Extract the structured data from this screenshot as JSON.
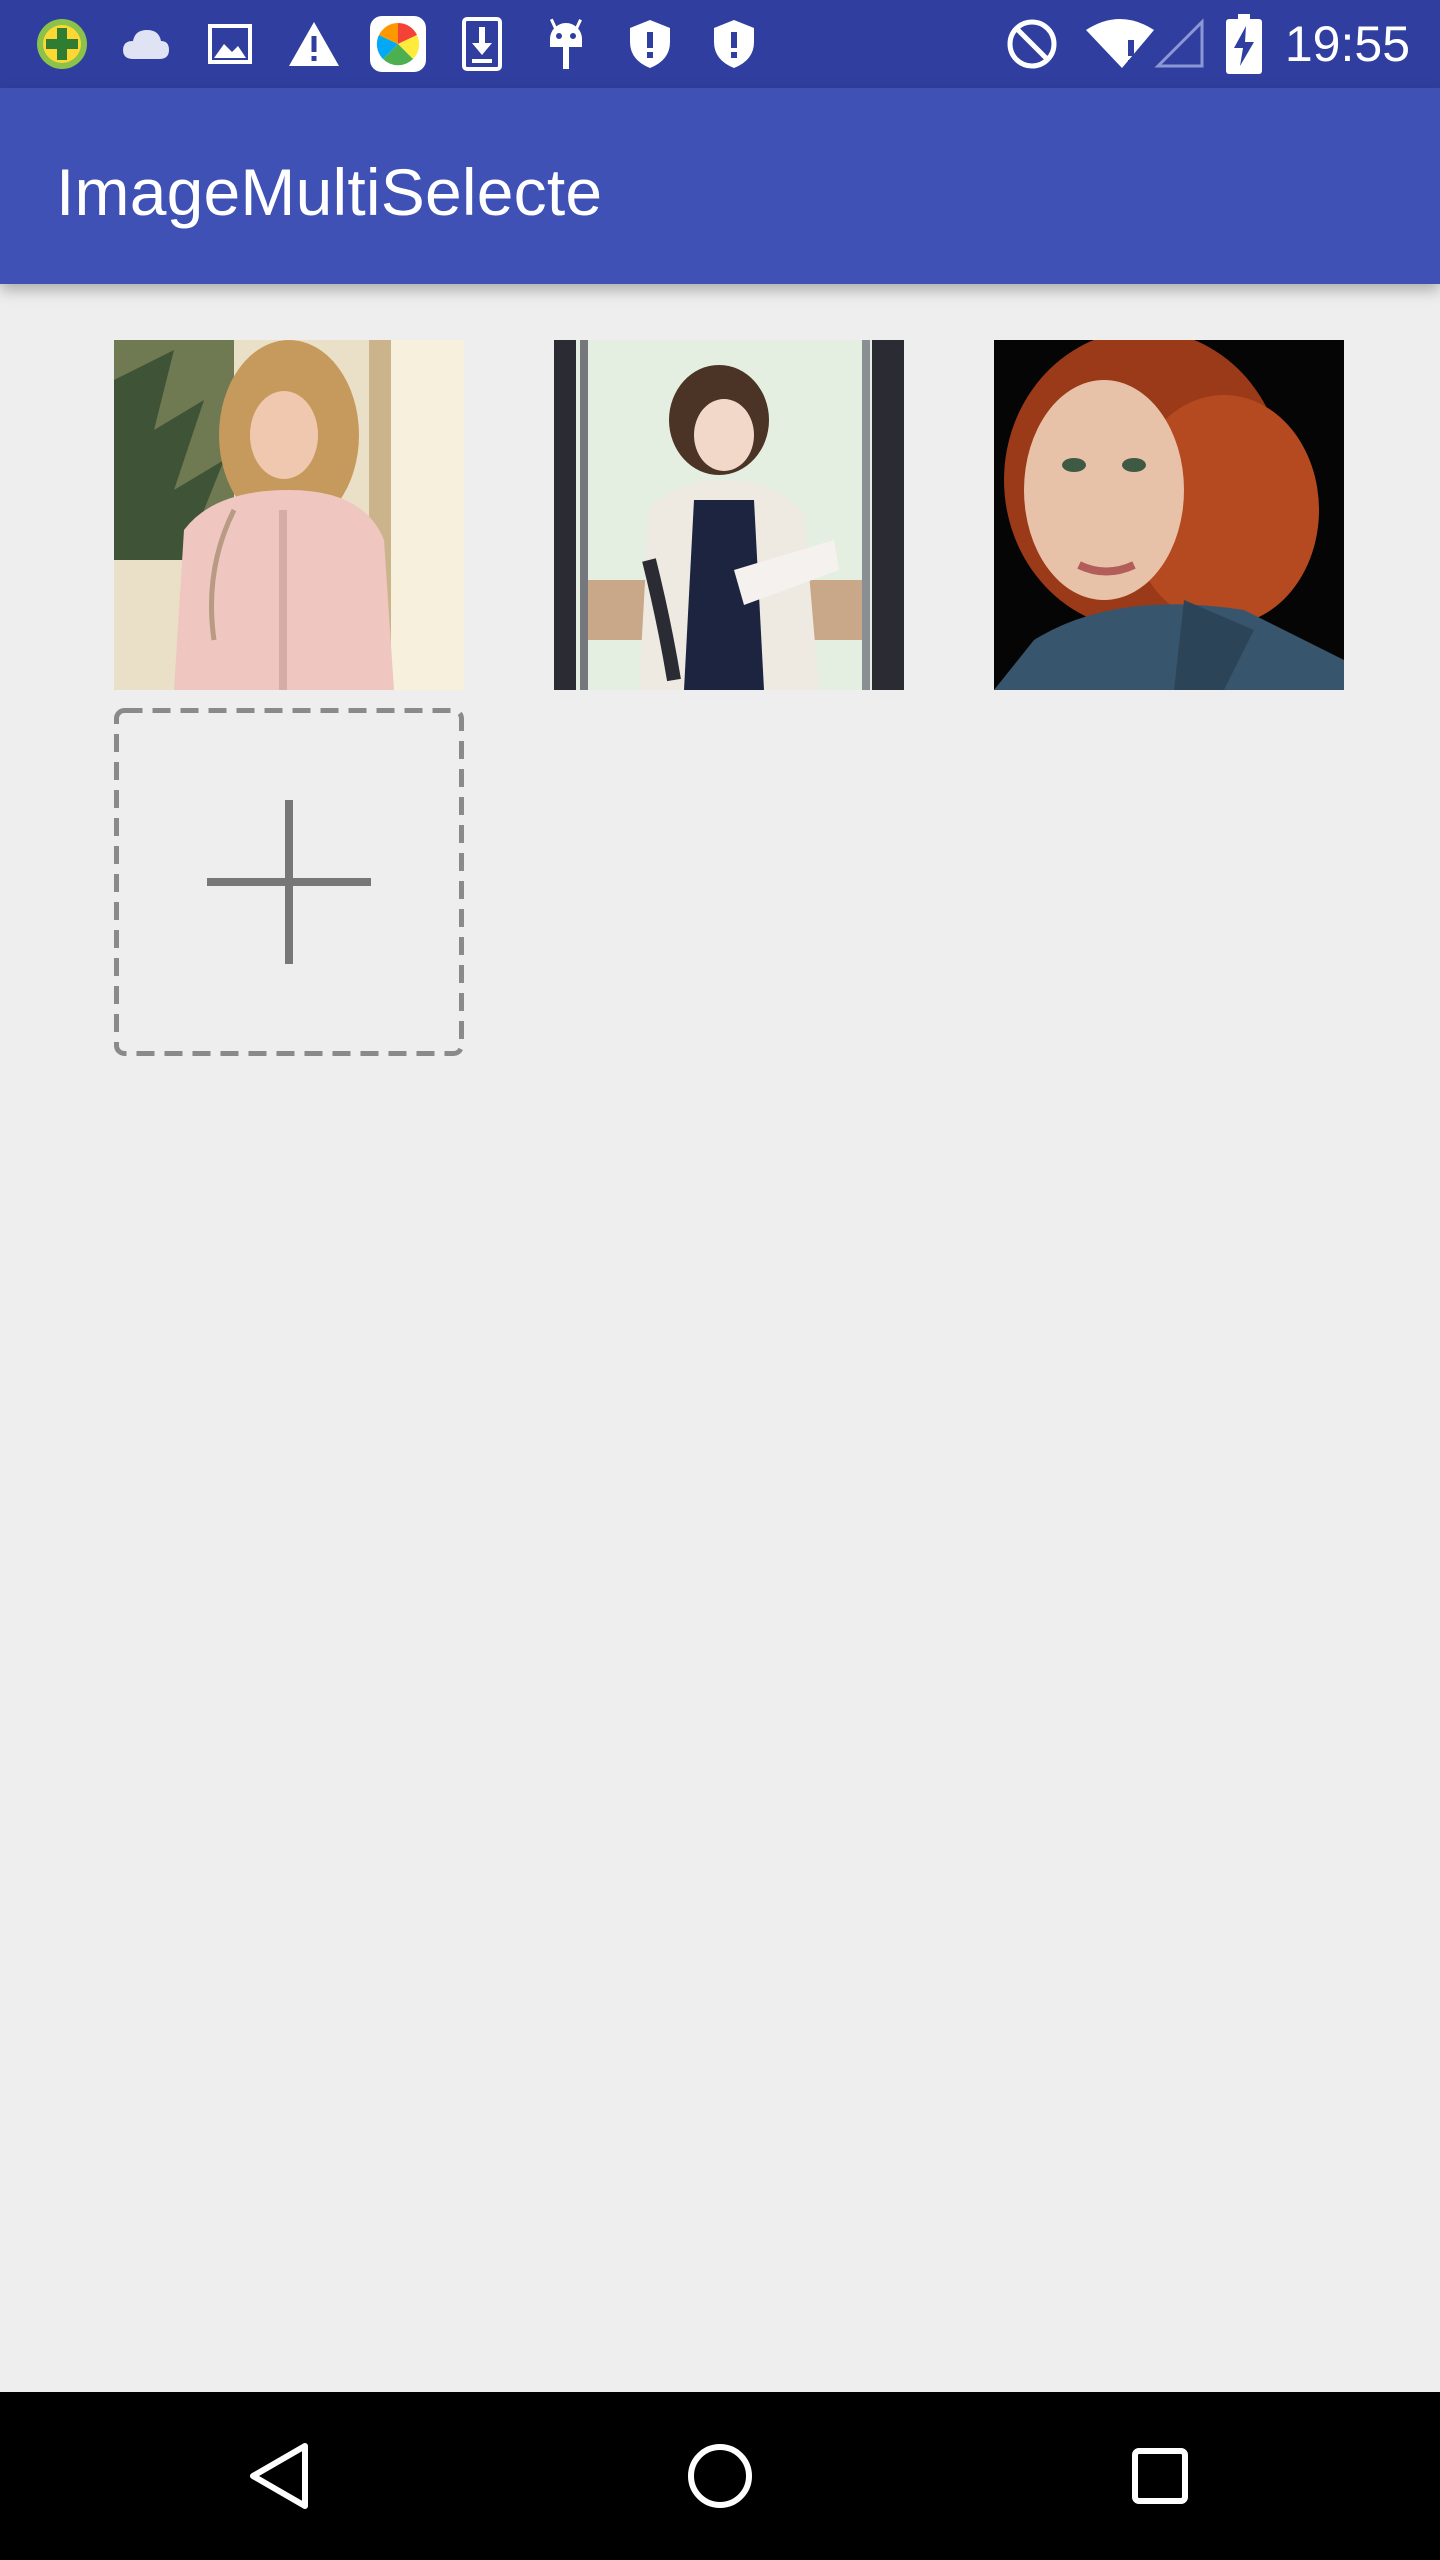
{
  "status_bar": {
    "time": "19:55",
    "icons_left": [
      "plus-badge-icon",
      "cloud-icon",
      "image-icon",
      "warning-icon",
      "app-colorful-icon",
      "download-icon",
      "android-icon",
      "shield-icon",
      "shield-icon"
    ],
    "icons_right": [
      "do-not-disturb-icon",
      "wifi-icon",
      "signal-icon",
      "battery-charging-icon"
    ],
    "background": "#303f9f"
  },
  "app_bar": {
    "title": "ImageMultiSelecte",
    "background": "#3f51b5"
  },
  "grid": {
    "images": [
      {
        "subject": "woman in pink blouse with long wavy hair",
        "dominant": "#e8d2c4"
      },
      {
        "subject": "woman in white jacket reading",
        "dominant": "#dfe8dc"
      },
      {
        "subject": "woman with red curly hair on black background",
        "dominant": "#111111"
      }
    ],
    "add_tile": {
      "icon": "plus-icon",
      "border_color": "#8a8a8a"
    }
  },
  "nav_bar": {
    "buttons": [
      "back-icon",
      "home-icon",
      "recents-icon"
    ],
    "background": "#000000"
  }
}
